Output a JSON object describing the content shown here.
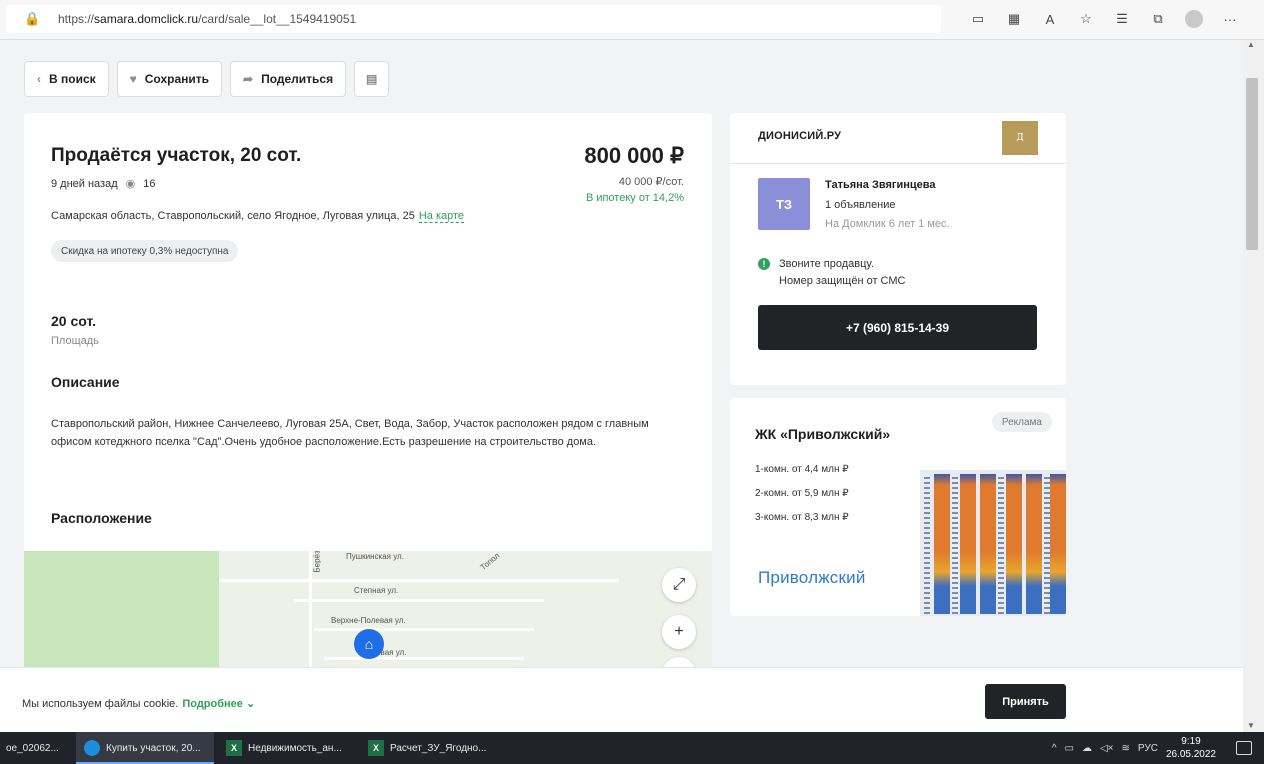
{
  "browser": {
    "url_prefix": "https://",
    "url_domain": "samara.domclick.ru",
    "url_path": "/card/sale__lot__1549419051"
  },
  "toolbar": {
    "back_label": "В поиск",
    "save_label": "Сохранить",
    "share_label": "Поделиться"
  },
  "listing": {
    "title": "Продаётся участок, 20 сот.",
    "price": "800 000 ₽",
    "age": "9 дней назад",
    "views": "16",
    "price_per_sot": "40 000 ₽/сот.",
    "mortgage": "В ипотеку от 14,2%",
    "address": "Самарская область, Ставропольский, село Ягодное, Луговая улица, 25",
    "map_link": "На карте",
    "discount_chip": "Скидка на ипотеку 0,3% недоступна",
    "area_value": "20 сот.",
    "area_label": "Площадь",
    "description_heading": "Описание",
    "description": "Ставропольский район, Нижнее Санчелеево, Луговая 25А, Свет, Вода, Забор, Участок расположен рядом с главным офисом котеджного пселка \"Сад\".Очень удобное расположение.Есть разрешение на строительство дома.",
    "location_heading": "Расположение"
  },
  "map": {
    "streets": [
      "Пушкинская ул.",
      "Степная ул.",
      "Верхне-Полевая ул.",
      "Луговая ул.",
      "Берёз",
      "Топол"
    ]
  },
  "seller": {
    "agency": "ДИОНИСИЙ.РУ",
    "initials": "ТЗ",
    "name": "Татьяна Звягинцева",
    "listings": "1 объявление",
    "since": "На Домклик 6 лет 1 мес.",
    "info_line1": "Звоните продавцу.",
    "info_line2": "Номер защищён от СМС",
    "phone": "+7 (960) 815-14-39"
  },
  "ad": {
    "tag": "Реклама",
    "title": "ЖК «Приволжский»",
    "rooms": [
      "1-комн. от 4,4 млн ₽",
      "2-комн. от 5,9 млн ₽",
      "3-комн. от 8,3 млн ₽"
    ],
    "brand": "Приволжский"
  },
  "cookie": {
    "text": "Мы используем файлы cookie.",
    "more": "Подробнее",
    "accept": "Принять"
  },
  "taskbar": {
    "items": [
      "ое_02062...",
      "Купить участок, 20...",
      "Недвижимость_ан...",
      "Расчет_ЗУ_Ягодно..."
    ],
    "lang": "РУС",
    "time": "9:19",
    "date": "26.05.2022"
  }
}
